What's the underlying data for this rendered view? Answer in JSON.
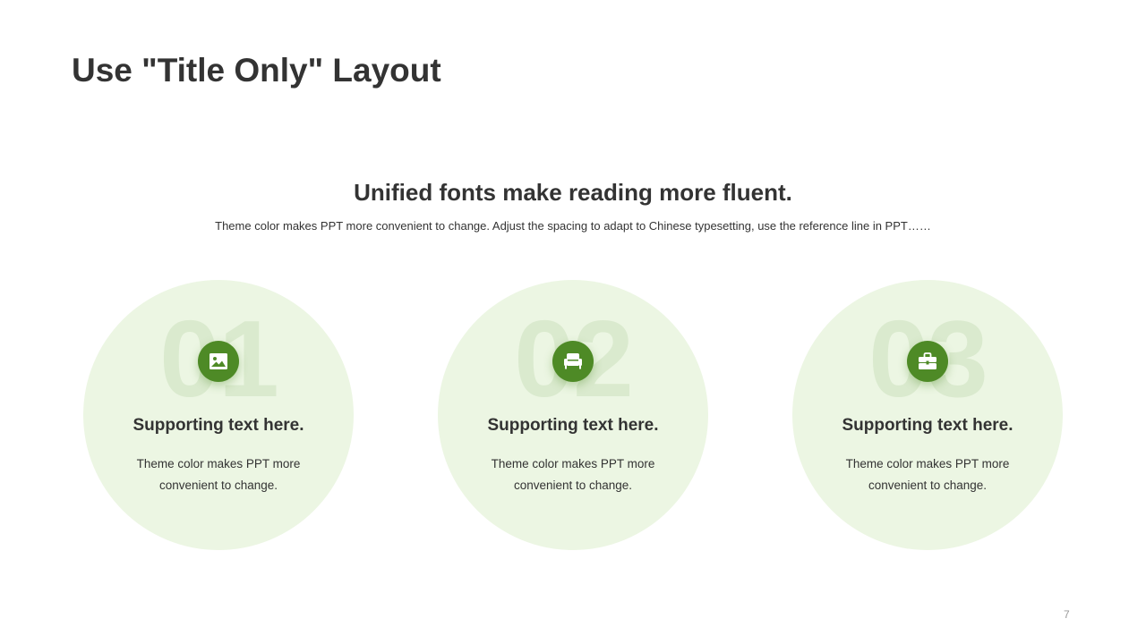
{
  "slide": {
    "title": "Use \"Title Only\" Layout",
    "headline": "Unified fonts make reading more fluent.",
    "subline": "Theme color makes PPT more convenient  to change. Adjust the spacing to adapt to Chinese  typesetting, use the reference line in PPT……",
    "page_number": "7"
  },
  "colors": {
    "accent": "#4e8a26",
    "card_background": "#ecf6e3",
    "number_watermark": "#d8e8cb",
    "text": "#333333"
  },
  "cards": [
    {
      "number": "01",
      "icon": "image-icon",
      "heading": "Supporting text here.",
      "body": "Theme color makes PPT more convenient  to change."
    },
    {
      "number": "02",
      "icon": "sofa-icon",
      "heading": "Supporting text here.",
      "body": "Theme color makes PPT more convenient  to change."
    },
    {
      "number": "03",
      "icon": "briefcase-icon",
      "heading": "Supporting text here.",
      "body": "Theme color makes PPT more convenient  to change."
    }
  ]
}
